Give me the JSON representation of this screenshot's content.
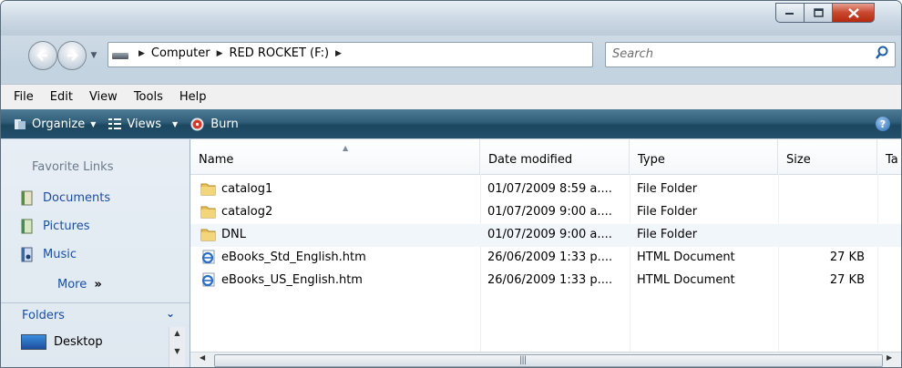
{
  "window": {
    "minimize_icon": "minimize-icon",
    "maximize_icon": "maximize-icon",
    "close_icon": "close-icon"
  },
  "address": {
    "drive_icon": "drive-icon",
    "crumbs": [
      "Computer",
      "RED ROCKET (F:)"
    ],
    "search_placeholder": "Search"
  },
  "menu": [
    "File",
    "Edit",
    "View",
    "Tools",
    "Help"
  ],
  "toolbar": {
    "organize": "Organize",
    "views": "Views",
    "burn": "Burn"
  },
  "sidebar": {
    "favorites_title": "Favorite Links",
    "links": [
      {
        "label": "Documents",
        "icon": "documents-icon"
      },
      {
        "label": "Pictures",
        "icon": "pictures-icon"
      },
      {
        "label": "Music",
        "icon": "music-icon"
      }
    ],
    "more": "More",
    "folders_title": "Folders",
    "tree": [
      {
        "label": "Desktop",
        "icon": "desktop-icon"
      }
    ]
  },
  "columns": [
    "Name",
    "Date modified",
    "Type",
    "Size",
    "Ta"
  ],
  "files": [
    {
      "name": "catalog1",
      "date": "01/07/2009 8:59 a....",
      "type": "File Folder",
      "size": "",
      "icon": "folder-icon"
    },
    {
      "name": "catalog2",
      "date": "01/07/2009 9:00 a....",
      "type": "File Folder",
      "size": "",
      "icon": "folder-icon"
    },
    {
      "name": "DNL",
      "date": "01/07/2009 9:00 a....",
      "type": "File Folder",
      "size": "",
      "icon": "folder-icon"
    },
    {
      "name": "eBooks_Std_English.htm",
      "date": "26/06/2009 1:33 p....",
      "type": "HTML Document",
      "size": "27 KB",
      "icon": "ie-document-icon"
    },
    {
      "name": "eBooks_US_English.htm",
      "date": "26/06/2009 1:33 p....",
      "type": "HTML Document",
      "size": "27 KB",
      "icon": "ie-document-icon"
    }
  ],
  "selected_row": 2,
  "colors": {
    "link": "#1a4fa0",
    "toolbar": "#2f5d77",
    "close": "#c8472d"
  }
}
